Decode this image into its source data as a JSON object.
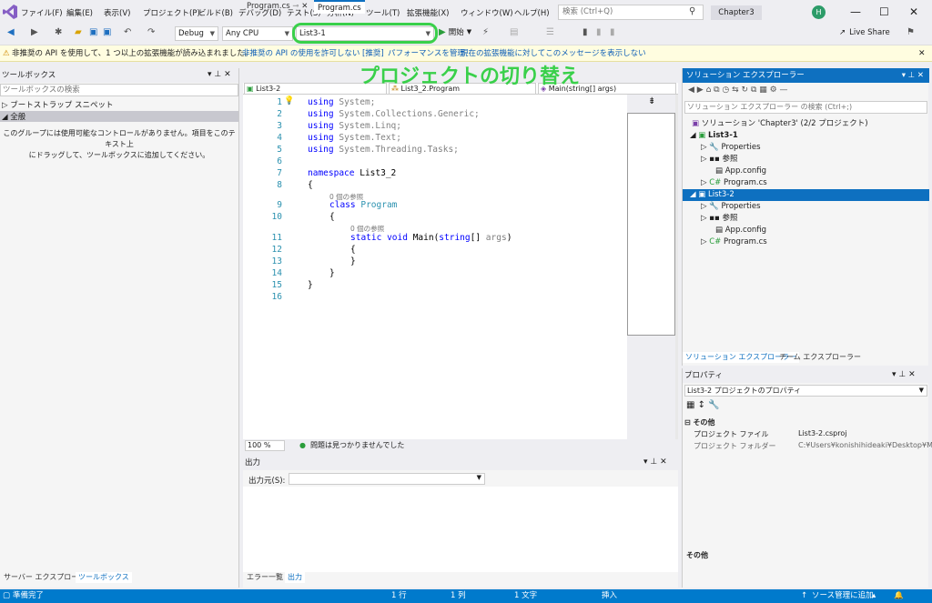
{
  "menu": {
    "items": [
      "ファイル(F)",
      "編集(E)",
      "表示(V)",
      "プロジェクト(P)",
      "ビルド(B)",
      "デバッグ(D)",
      "テスト(S)",
      "分析(N)",
      "ツール(T)",
      "拡張機能(X)",
      "ウィンドウ(W)",
      "ヘルプ(H)"
    ],
    "search_placeholder": "検索 (Ctrl+Q)",
    "solution_name": "Chapter3",
    "avatar_initial": "H"
  },
  "toolbar": {
    "config": "Debug",
    "platform": "Any CPU",
    "project": "List3-1",
    "start_label": "開始",
    "live_share": "Live Share"
  },
  "infobar": {
    "message": "非推奨の API を使用して、1 つ以上の拡張機能が読み込まれました。",
    "link1": "非推奨の API の使用を許可しない [推奨]",
    "link2": "パフォーマンスを管理",
    "link3": "現在の拡張機能に対してこのメッセージを表示しない"
  },
  "toolbox": {
    "title": "ツールボックス",
    "search_placeholder": "ツールボックスの検索",
    "group1": "ブートストラップ スニペット",
    "group2": "全般",
    "empty_text_1": "このグループには使用可能なコントロールがありません。項目をこのテキスト上",
    "empty_text_2": "にドラッグして、ツールボックスに追加してください。",
    "tab_server": "サーバー エクスプローラー",
    "tab_toolbox": "ツールボックス"
  },
  "editor": {
    "tab1": "Program.cs",
    "tab2": "Program.cs",
    "nav_project": "List3-2",
    "nav_class": "List3_2.Program",
    "nav_member": "Main(string[] args)",
    "ref_label": "0 個の参照",
    "code": {
      "l1": "System;",
      "l2": "System.Collections.Generic;",
      "l3": "System.Linq;",
      "l4": "System.Text;",
      "l5": "System.Threading.Tasks;",
      "kw_using": "using",
      "kw_namespace": "namespace",
      "ns_name": "List3_2",
      "kw_class": "class",
      "class_name": "Program",
      "kw_static": "static",
      "kw_void": "void",
      "method": "Main(",
      "kw_string": "string",
      "args": "[] ",
      "args_name": "args",
      "close_paren": ")",
      "brace_open": "{",
      "brace_close": "}"
    },
    "line_numbers": [
      "1",
      "2",
      "3",
      "4",
      "5",
      "6",
      "7",
      "8",
      "9",
      "10",
      "11",
      "12",
      "13",
      "14",
      "15",
      "16"
    ],
    "zoom": "100 %",
    "status_text": "問題は見つかりませんでした"
  },
  "overlay_title": "プロジェクトの切り替え",
  "output": {
    "title": "出力",
    "source_label": "出力元(S):",
    "tab_errors": "エラー一覧",
    "tab_output": "出力"
  },
  "solution_explorer": {
    "title": "ソリューション エクスプローラー",
    "search_placeholder": "ソリューション エクスプローラー の検索 (Ctrl+;)",
    "solution": "ソリューション 'Chapter3' (2/2 プロジェクト)",
    "project1": "List3-1",
    "project2": "List3-2",
    "properties": "Properties",
    "references": "参照",
    "appconfig": "App.config",
    "programcs": "Program.cs",
    "tab_solution": "ソリューション エクスプローラー",
    "tab_team": "チーム エクスプローラー"
  },
  "properties": {
    "title": "プロパティ",
    "object": "List3-2  プロジェクトのプロパティ",
    "category": "その他",
    "file_label": "プロジェクト ファイル",
    "file_value": "List3-2.csproj",
    "folder_label": "プロジェクト フォルダー",
    "folder_value": "C:¥Users¥konishihideaki¥Desktop¥M",
    "desc_title": "その他"
  },
  "statusbar": {
    "ready": "準備完了",
    "line": "1 行",
    "col": "1 列",
    "chars": "1 文字",
    "mode": "挿入",
    "source_control": "ソース管理に追加"
  },
  "colors": {
    "accent": "#007acc",
    "highlight": "#39d04a"
  }
}
